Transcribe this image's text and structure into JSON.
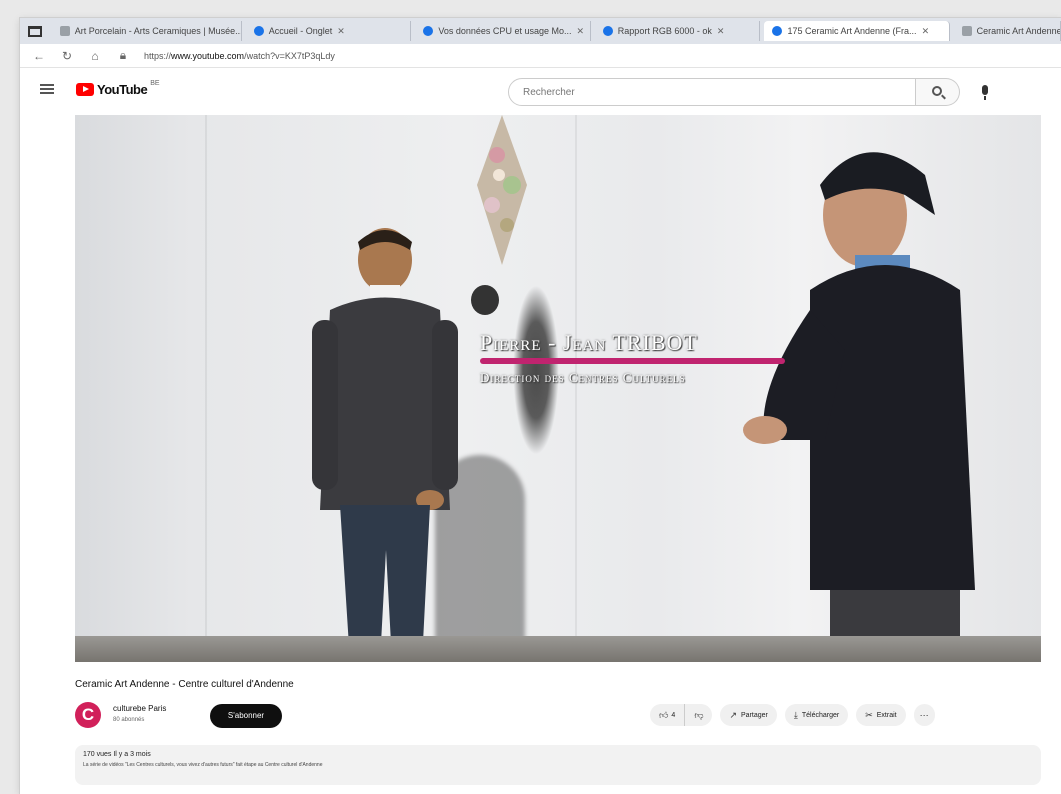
{
  "browser": {
    "tabs": [
      {
        "label": "Art Porcelain - Arts Ceramiques | Musée...",
        "active": false
      },
      {
        "label": "Accueil - Onglet",
        "active": false
      },
      {
        "label": "Vos données CPU et usage Mo...",
        "active": false
      },
      {
        "label": "Rapport RGB 6000 - ok",
        "active": false
      },
      {
        "label": "175 Ceramic Art Andenne (Fra...",
        "active": true
      },
      {
        "label": "Ceramic Art Andenne",
        "active": false
      }
    ],
    "url_prefix": "https://",
    "url_domain": "www.youtube.com",
    "url_path": "/watch?v=KX7tP3qLdy"
  },
  "youtube": {
    "logo_text": "YouTube",
    "logo_sup": "BE",
    "search_placeholder": "Rechercher"
  },
  "video": {
    "overlay_name": "Pierre - Jean TRIBOT",
    "overlay_role": "Direction des Centres Culturels",
    "title": "Ceramic Art Andenne - Centre culturel d'Andenne",
    "channel_name": "culturebe Paris",
    "channel_subs": "80 abonnés",
    "avatar_letter": "C",
    "subscribe_label": "S'abonner",
    "like_count": "4",
    "share_label": "Partager",
    "download_label": "Télécharger",
    "clip_label": "Extrait",
    "description_meta": "170 vues  Il y a 3 mois",
    "description_text": "La série de vidéos \"Les Centres culturels, vous vivez d'autres futurs\" fait étape au Centre culturel d'Andenne"
  },
  "colors": {
    "accent_bar": "#c0246f",
    "yt_red": "#ff0000",
    "avatar_bg": "#d1205a"
  }
}
